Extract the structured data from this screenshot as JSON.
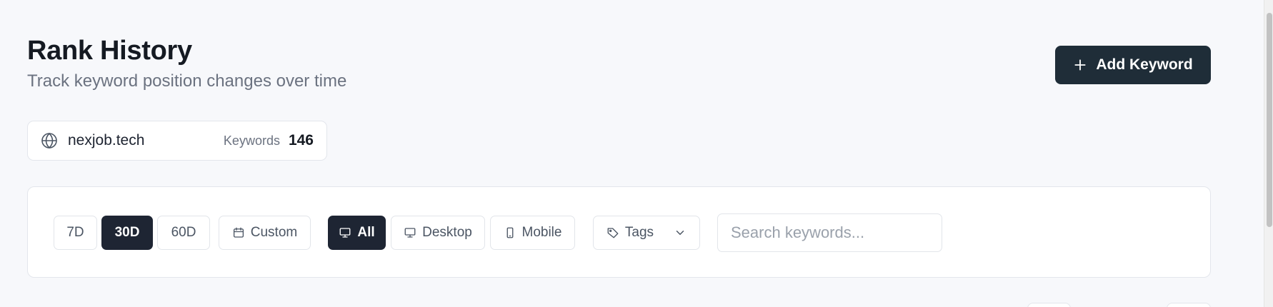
{
  "header": {
    "title": "Rank History",
    "subtitle": "Track keyword position changes over time",
    "add_button_label": "Add Keyword",
    "add_button_icon": "plus-icon"
  },
  "domain": {
    "icon": "globe-icon",
    "name": "nexjob.tech",
    "keywords_label": "Keywords",
    "keywords_count": "146"
  },
  "filters": {
    "date_ranges": [
      {
        "label": "7D",
        "active": false
      },
      {
        "label": "30D",
        "active": true
      },
      {
        "label": "60D",
        "active": false
      }
    ],
    "custom_label": "Custom",
    "custom_icon": "calendar-icon",
    "devices": [
      {
        "label": "All",
        "icon": "monitor-icon",
        "active": true
      },
      {
        "label": "Desktop",
        "icon": "monitor-icon",
        "active": false
      },
      {
        "label": "Mobile",
        "icon": "smartphone-icon",
        "active": false
      }
    ],
    "tags_label": "Tags",
    "tags_icon": "tag-icon",
    "search_placeholder": "Search keywords..."
  },
  "colors": {
    "primary_dark": "#1f2d38",
    "active_chip": "#1e2533",
    "background": "#f7f8fb"
  }
}
